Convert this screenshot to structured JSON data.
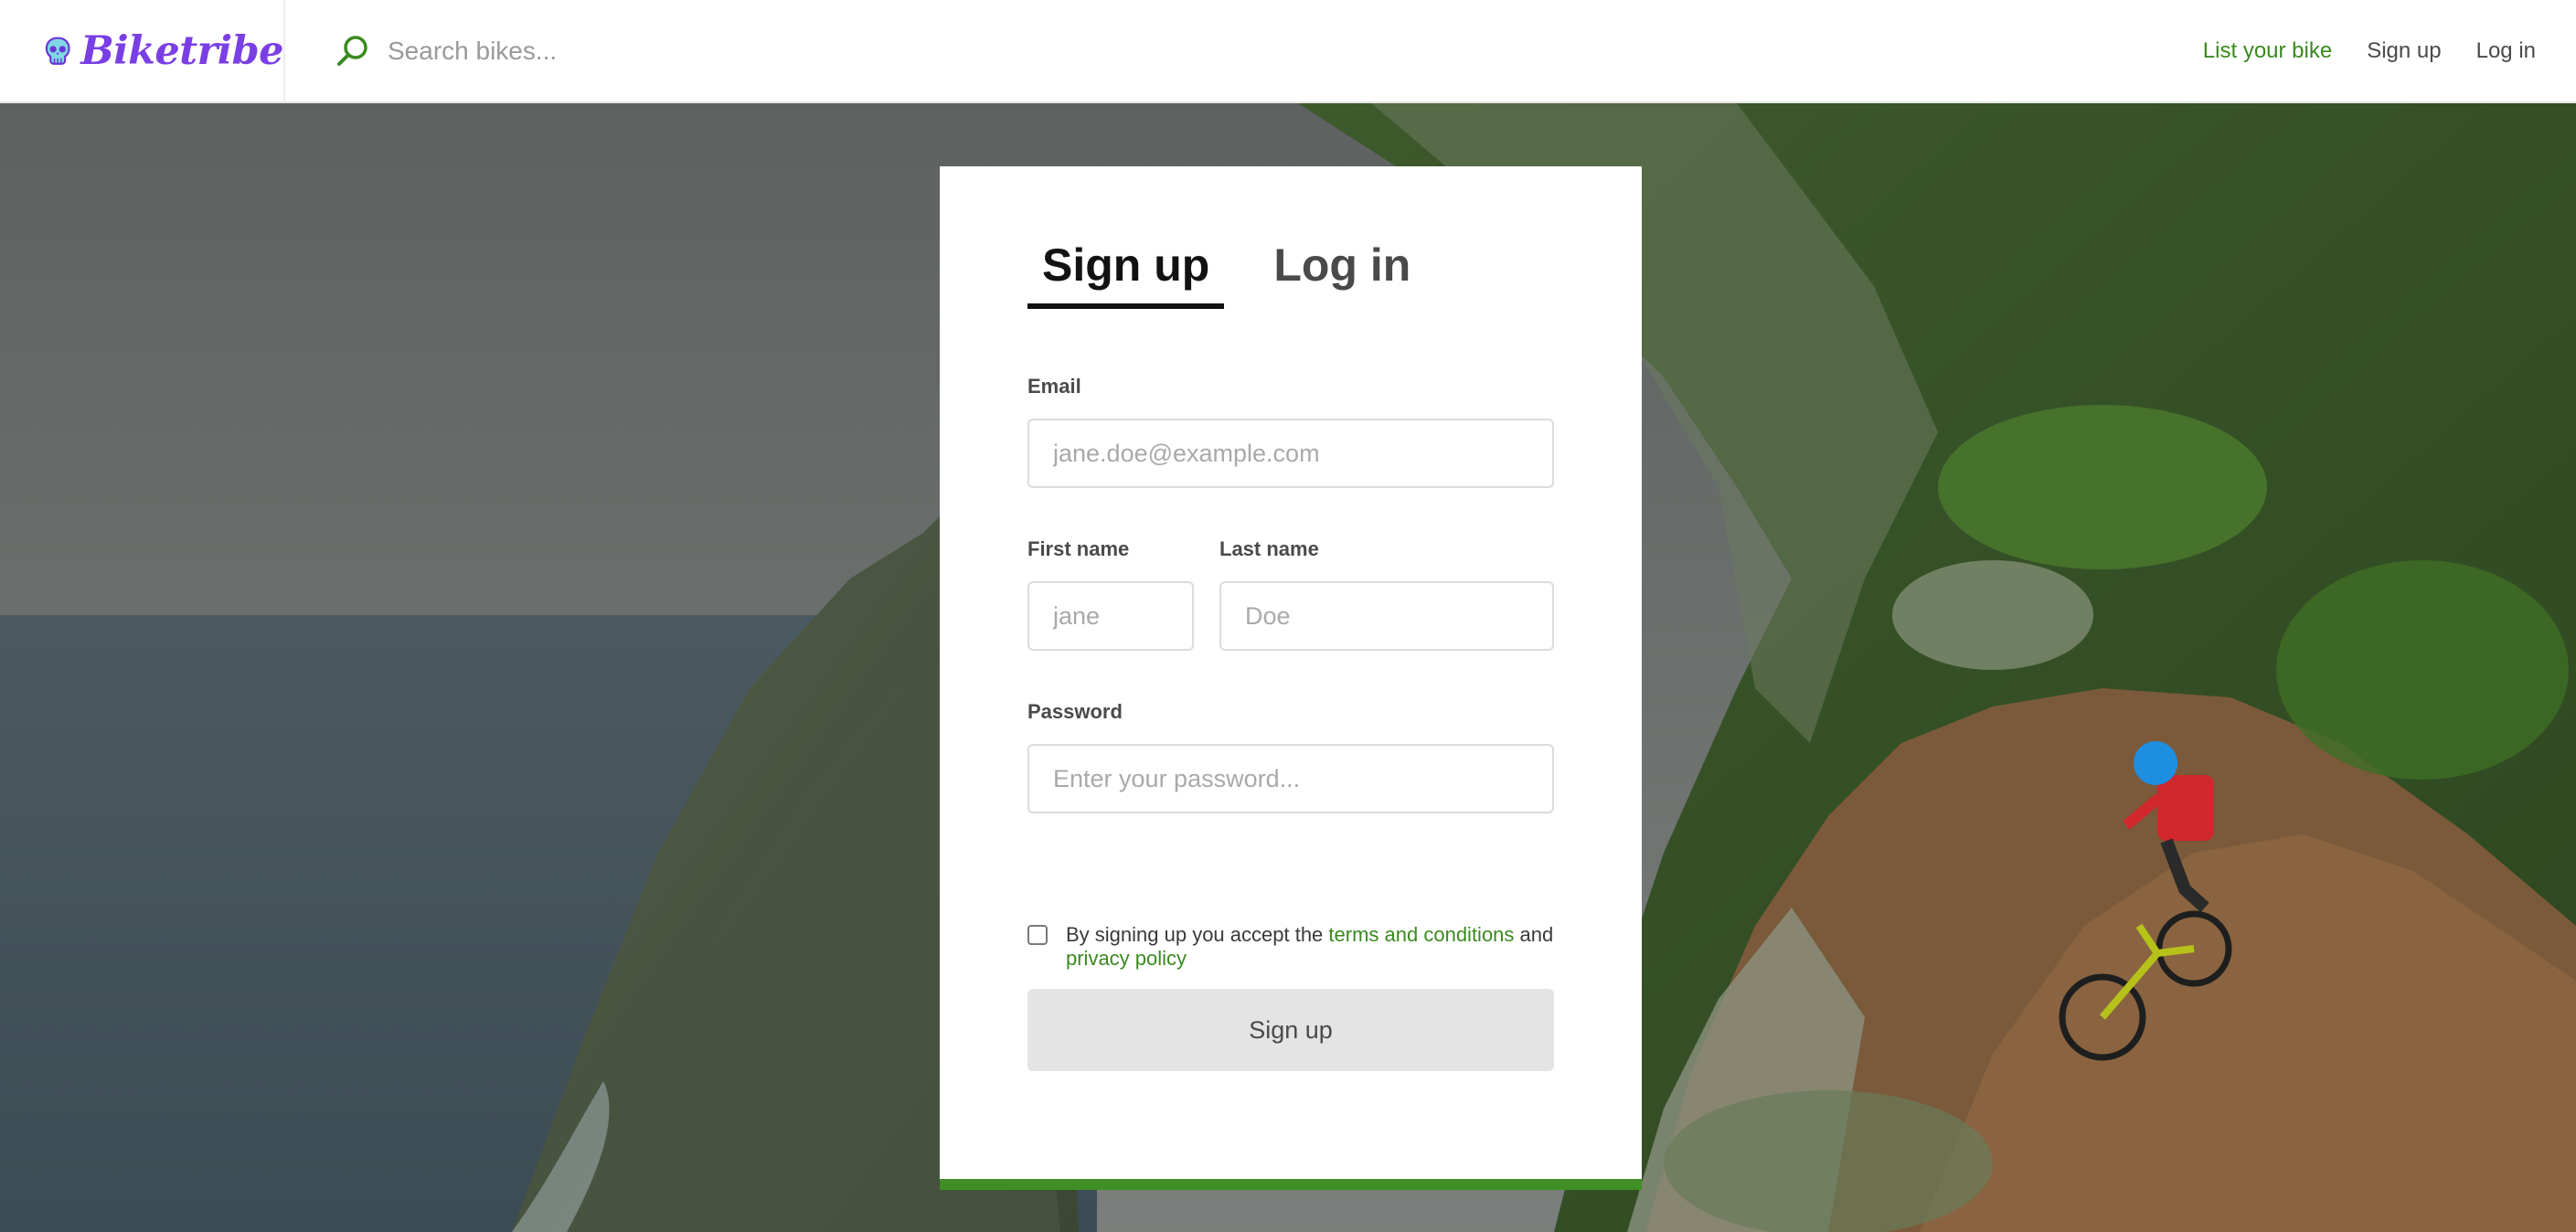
{
  "brand": {
    "name": "Biketribe",
    "logo_icon": "skull-icon",
    "color": "#7a3fe4"
  },
  "search": {
    "placeholder": "Search bikes...",
    "icon": "search-icon"
  },
  "nav": {
    "list_bike": "List your bike",
    "signup": "Sign up",
    "login": "Log in"
  },
  "tabs": {
    "signup": "Sign up",
    "login": "Log in",
    "active": "signup"
  },
  "form": {
    "email_label": "Email",
    "email_placeholder": "jane.doe@example.com",
    "first_name_label": "First name",
    "first_name_placeholder": "jane",
    "last_name_label": "Last name",
    "last_name_placeholder": "Doe",
    "password_label": "Password",
    "password_placeholder": "Enter your password...",
    "terms_prefix": "By signing up you accept the ",
    "terms_link": "terms and conditions",
    "terms_middle": " and ",
    "privacy_link": "privacy policy",
    "terms_checked": false,
    "submit_label": "Sign up"
  },
  "colors": {
    "accent_green": "#3a8a1f",
    "card_bottom_bar": "#3f8f24",
    "disabled_button": "#e4e4e4"
  }
}
